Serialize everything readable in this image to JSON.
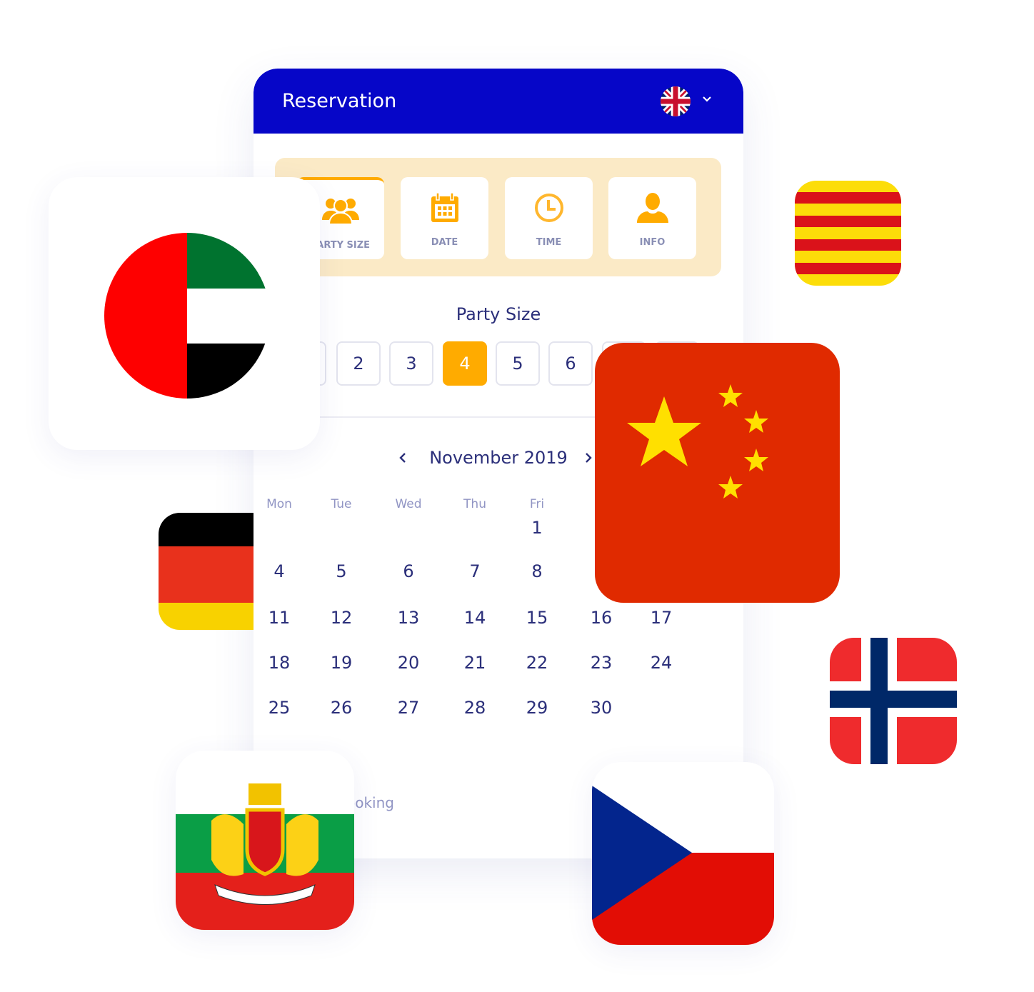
{
  "header": {
    "title": "Reservation",
    "language_flag": "united-kingdom",
    "chevron": "chevron-down-icon"
  },
  "steps": [
    {
      "label": "PARTY SIZE",
      "icon": "group-icon",
      "active": true
    },
    {
      "label": "DATE",
      "icon": "calendar-icon"
    },
    {
      "label": "TIME",
      "icon": "clock-icon"
    },
    {
      "label": "INFO",
      "icon": "user-icon"
    }
  ],
  "party": {
    "title": "Party Size",
    "options": [
      "2",
      "3",
      "4",
      "5",
      "6"
    ],
    "selected": "4"
  },
  "calendar": {
    "month": "November 2019",
    "weekdays": [
      "Mon",
      "Tue",
      "Wed",
      "Thu",
      "Fri"
    ],
    "weeks": [
      [
        "",
        "",
        "",
        "",
        "1",
        "",
        ""
      ],
      [
        "4",
        "5",
        "6",
        "7",
        "8",
        "",
        ""
      ],
      [
        "11",
        "12",
        "13",
        "14",
        "15",
        "16",
        "17"
      ],
      [
        "18",
        "19",
        "20",
        "21",
        "22",
        "23",
        "24"
      ],
      [
        "25",
        "26",
        "27",
        "28",
        "29",
        "30",
        ""
      ]
    ]
  },
  "footer": {
    "booking_text": "ooking"
  },
  "colors": {
    "header": "#0606c8",
    "accent": "#ffab00",
    "text": "#2b2f7a"
  },
  "flags": [
    "united-arab-emirates",
    "catalonia",
    "china",
    "germany",
    "norway",
    "bulgaria",
    "czech-republic"
  ]
}
